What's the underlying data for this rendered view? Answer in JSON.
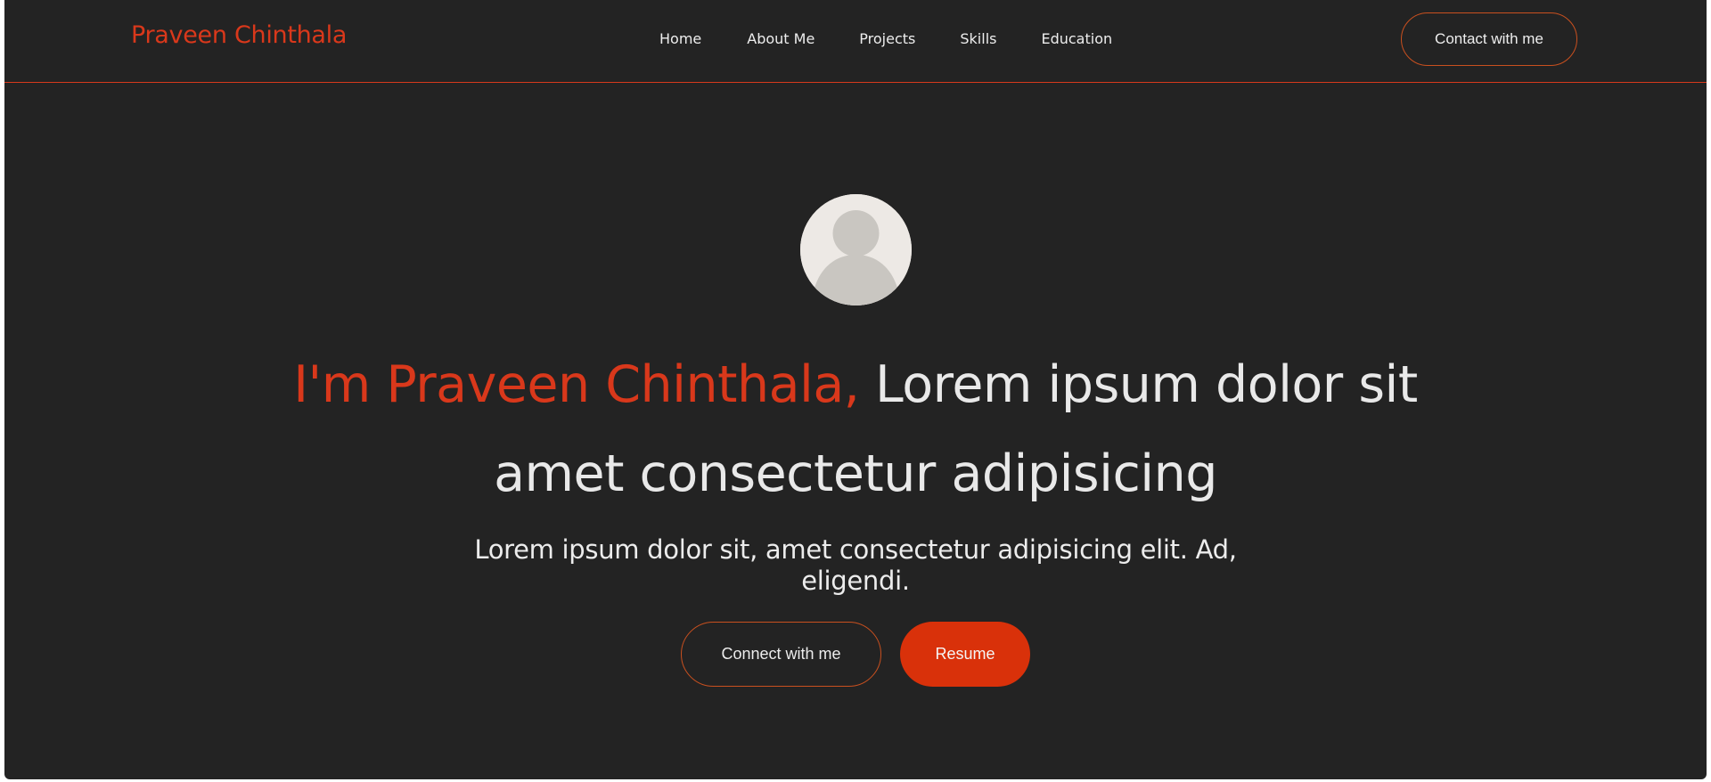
{
  "navbar": {
    "brand": "Praveen Chinthala",
    "links": [
      {
        "label": "Home"
      },
      {
        "label": "About Me"
      },
      {
        "label": "Projects"
      },
      {
        "label": "Skills"
      },
      {
        "label": "Education"
      }
    ],
    "contact_label": "Contact with me"
  },
  "hero": {
    "avatar_icon": "user-avatar-icon",
    "headline_accent": "I'm Praveen Chinthala,",
    "headline_line1_rest": " Lorem ipsum dolor sit",
    "headline_line2": "amet consectetur adipisicing",
    "subtitle_line1": "Lorem ipsum dolor sit, amet consectetur adipisicing elit. Ad,",
    "subtitle_line2": "eligendi.",
    "connect_label": "Connect with me",
    "resume_label": "Resume"
  },
  "colors": {
    "background": "#232323",
    "accent": "#d9381b",
    "text": "#e9e9e9",
    "resume_button": "#d9310a"
  }
}
